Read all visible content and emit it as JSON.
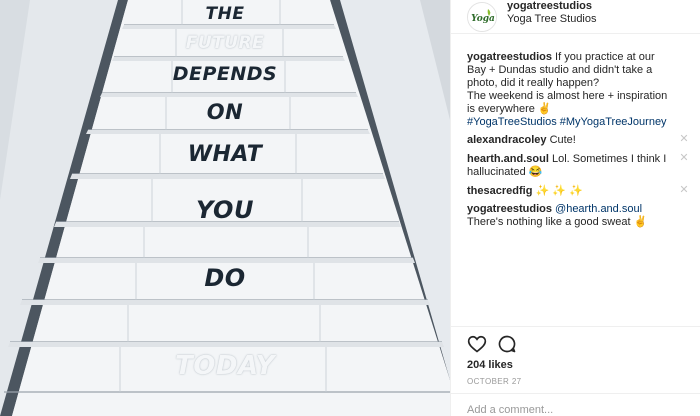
{
  "post": {
    "image_alt_words": [
      "THE",
      "FUTURE",
      "DEPENDS",
      "ON",
      "WHAT",
      "YOU",
      "DO",
      "TODAY"
    ]
  },
  "header": {
    "username": "yogatreestudios",
    "location": "Yoga Tree Studios",
    "avatar_text": "Yoga"
  },
  "caption": {
    "username": "yogatreestudios",
    "text": "If you practice at our Bay + Dundas studio and didn't take a photo, did it really happen?",
    "text2": "The weekend is almost here + inspiration is everywhere ✌️",
    "hashtags": "#YogaTreeStudios #MyYogaTreeJourney"
  },
  "comments": [
    {
      "username": "alexandracoley",
      "text": "Cute!"
    },
    {
      "username": "hearth.and.soul",
      "text": "Lol. Sometimes I think I hallucinated 😂"
    },
    {
      "username": "thesacredfig",
      "text": "✨ ✨ ✨"
    },
    {
      "username": "yogatreestudios",
      "mention": "@hearth.and.soul",
      "text": "There's nothing like a good sweat ✌️"
    }
  ],
  "actions": {
    "likes": "204 likes",
    "date": "OCTOBER 27",
    "comment_placeholder": "Add a comment..."
  },
  "icons": {
    "like": "heart-icon",
    "comment": "comment-icon",
    "delete": "close-icon"
  },
  "colors": {
    "text": "#262626",
    "muted": "#999999",
    "hashtag": "#003569",
    "divider": "#efefef",
    "step_text": "#1b2733"
  }
}
